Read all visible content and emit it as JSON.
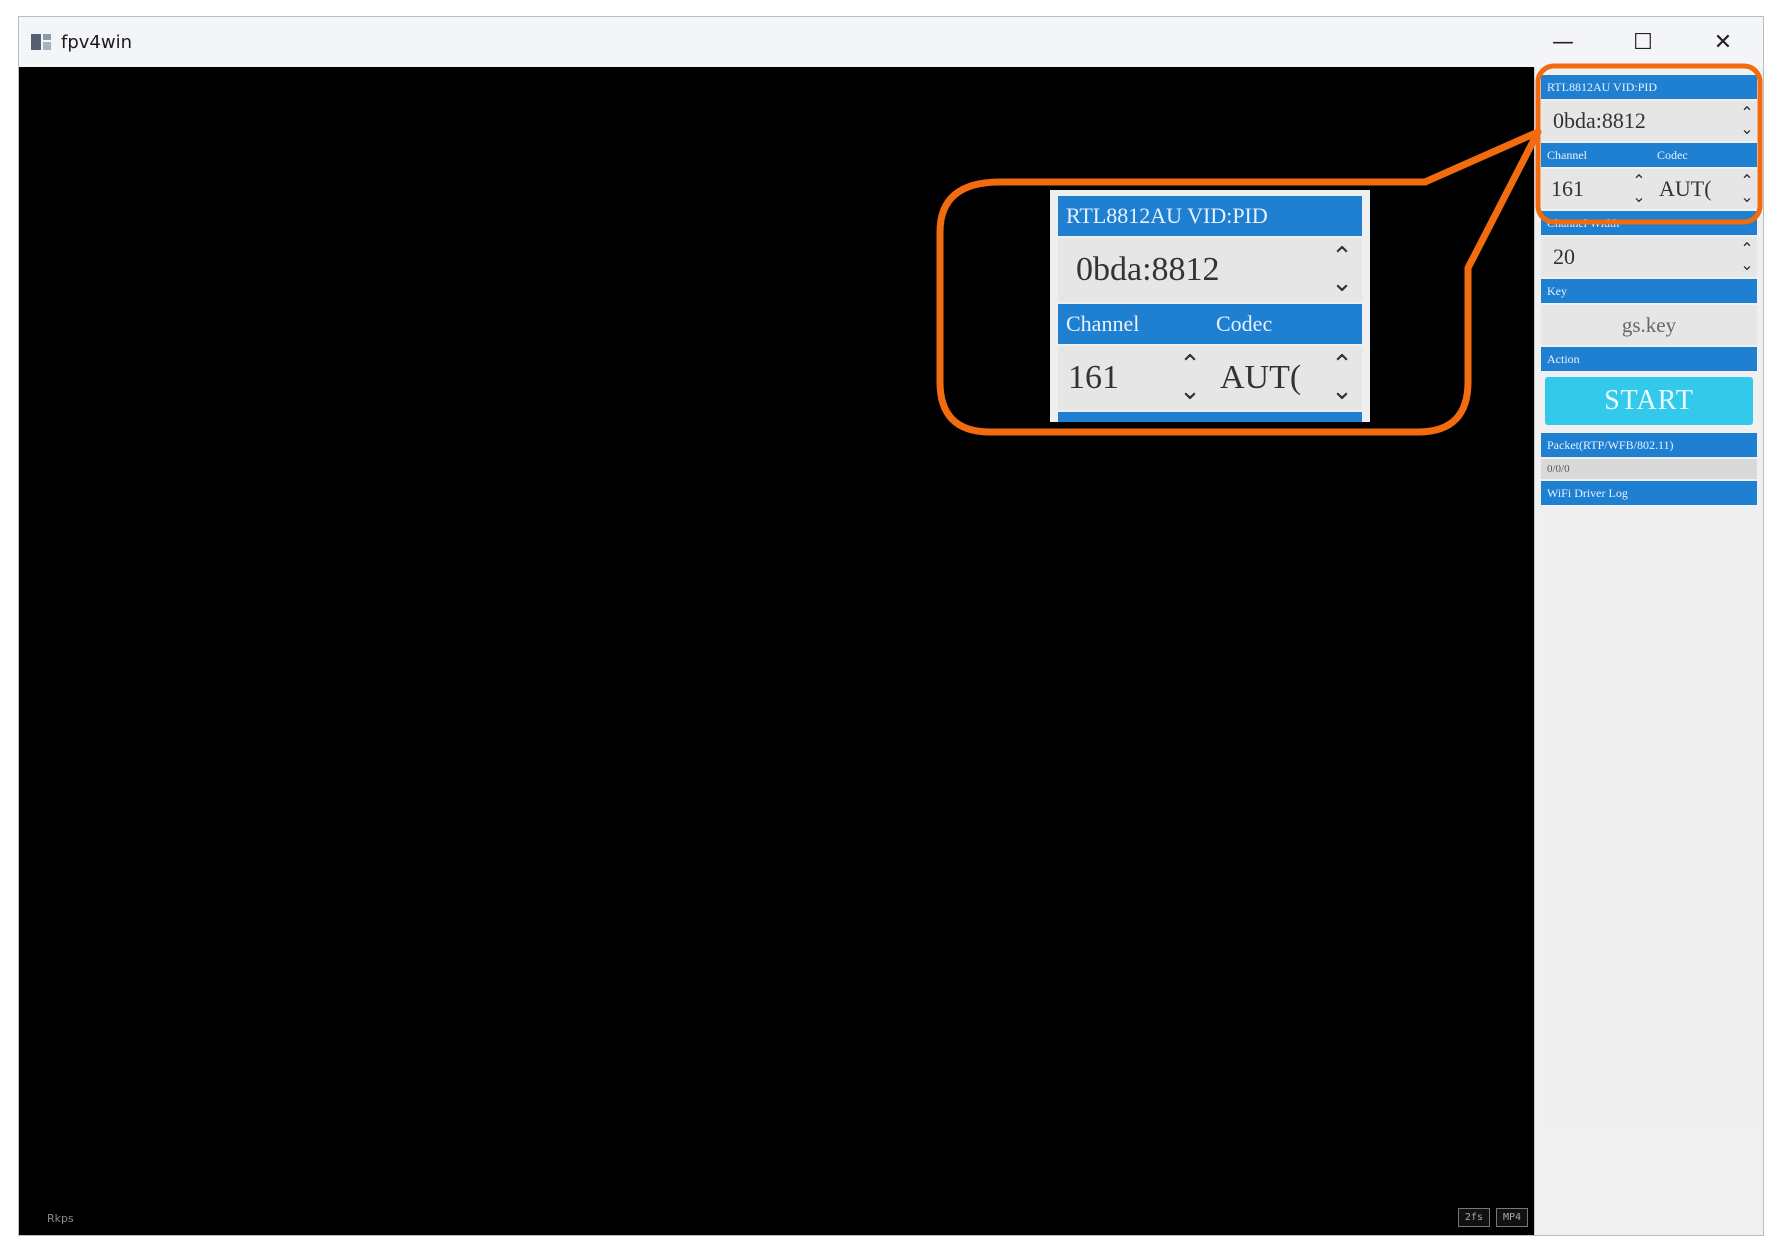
{
  "window": {
    "title": "fpv4win",
    "controls": {
      "minimize": "—",
      "maximize": "☐",
      "close": "✕"
    }
  },
  "video": {
    "footer_left": "Rkps",
    "footer_buttons": [
      "2fs",
      "MP4"
    ]
  },
  "panel": {
    "device_header": "RTL8812AU VID:PID",
    "device_value": "0bda:8812",
    "channel_header": "Channel",
    "codec_header": "Codec",
    "channel_value": "161",
    "codec_value": "AUT(",
    "width_header": "Channel Width",
    "width_value": "20",
    "key_header": "Key",
    "key_value": "gs.key",
    "action_header": "Action",
    "start_label": "START",
    "packet_header": "Packet(RTP/WFB/802.11)",
    "packet_value": "0/0/0",
    "log_header": "WiFi Driver Log"
  },
  "zoom": {
    "device_header": "RTL8812AU VID:PID",
    "device_value": "0bda:8812",
    "channel_header": "Channel",
    "codec_header": "Codec",
    "channel_value": "161",
    "codec_value": "AUT(",
    "width_header_partial": "Channel Width"
  },
  "icons": {
    "spin": "up-down-chevron-icon",
    "app": "app-icon"
  },
  "colors": {
    "header_blue": "#1f7fd1",
    "start_cyan": "#33c9ea",
    "callout_orange": "#f26b0f"
  }
}
